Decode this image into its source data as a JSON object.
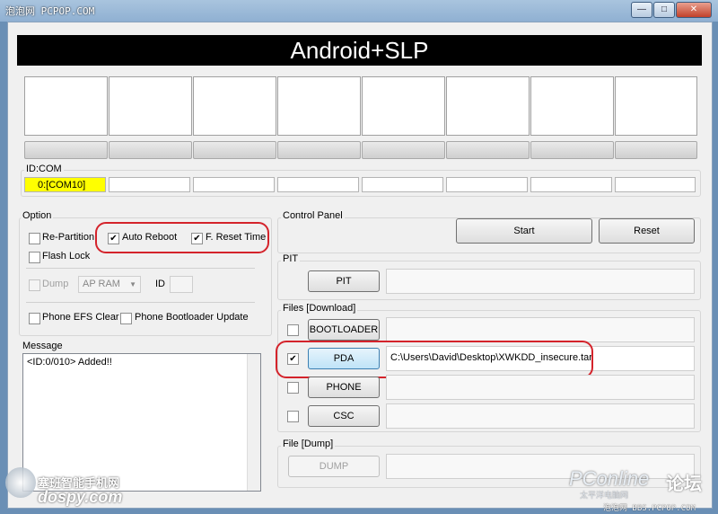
{
  "window": {
    "watermark_top": "泡泡网 PCPOP.COM"
  },
  "banner": {
    "title": "Android+SLP"
  },
  "id_com": {
    "label": "ID:COM",
    "slots": [
      "0:[COM10]",
      "",
      "",
      "",
      "",
      "",
      "",
      ""
    ]
  },
  "option": {
    "label": "Option",
    "re_partition": {
      "label": "Re-Partition",
      "checked": false
    },
    "auto_reboot": {
      "label": "Auto Reboot",
      "checked": true
    },
    "f_reset_time": {
      "label": "F. Reset Time",
      "checked": true
    },
    "flash_lock": {
      "label": "Flash Lock",
      "checked": false
    },
    "dump": {
      "label": "Dump",
      "checked": false
    },
    "ap_ram": {
      "value": "AP RAM"
    },
    "id_label": "ID",
    "phone_efs_clear": {
      "label": "Phone EFS Clear",
      "checked": false
    },
    "phone_bootloader_update": {
      "label": "Phone Bootloader Update",
      "checked": false
    }
  },
  "message": {
    "label": "Message",
    "text": "<ID:0/010> Added!!"
  },
  "control_panel": {
    "label": "Control Panel",
    "start": "Start",
    "reset": "Reset"
  },
  "pit": {
    "label": "PIT",
    "button": "PIT",
    "path": ""
  },
  "files_download": {
    "label": "Files [Download]",
    "rows": [
      {
        "button": "BOOTLOADER",
        "checked": false,
        "path": ""
      },
      {
        "button": "PDA",
        "checked": true,
        "path": "C:\\Users\\David\\Desktop\\XWKDD_insecure.tar"
      },
      {
        "button": "PHONE",
        "checked": false,
        "path": ""
      },
      {
        "button": "CSC",
        "checked": false,
        "path": ""
      }
    ]
  },
  "file_dump": {
    "label": "File [Dump]",
    "button": "DUMP",
    "path": ""
  },
  "watermarks": {
    "bottom_left_cn": "塞班智能手机网",
    "bottom_left_en": "dospy.com",
    "bottom_right_logo": "PConline",
    "bottom_right_cn": "论坛",
    "bottom_right_sub": "太平洋电脑网",
    "bottom_right_url": "泡泡网 BBS.PCPOP.COM"
  },
  "colors": {
    "highlight": "#ffff00",
    "annotation": "#d4232b",
    "banner_bg": "#000000"
  }
}
